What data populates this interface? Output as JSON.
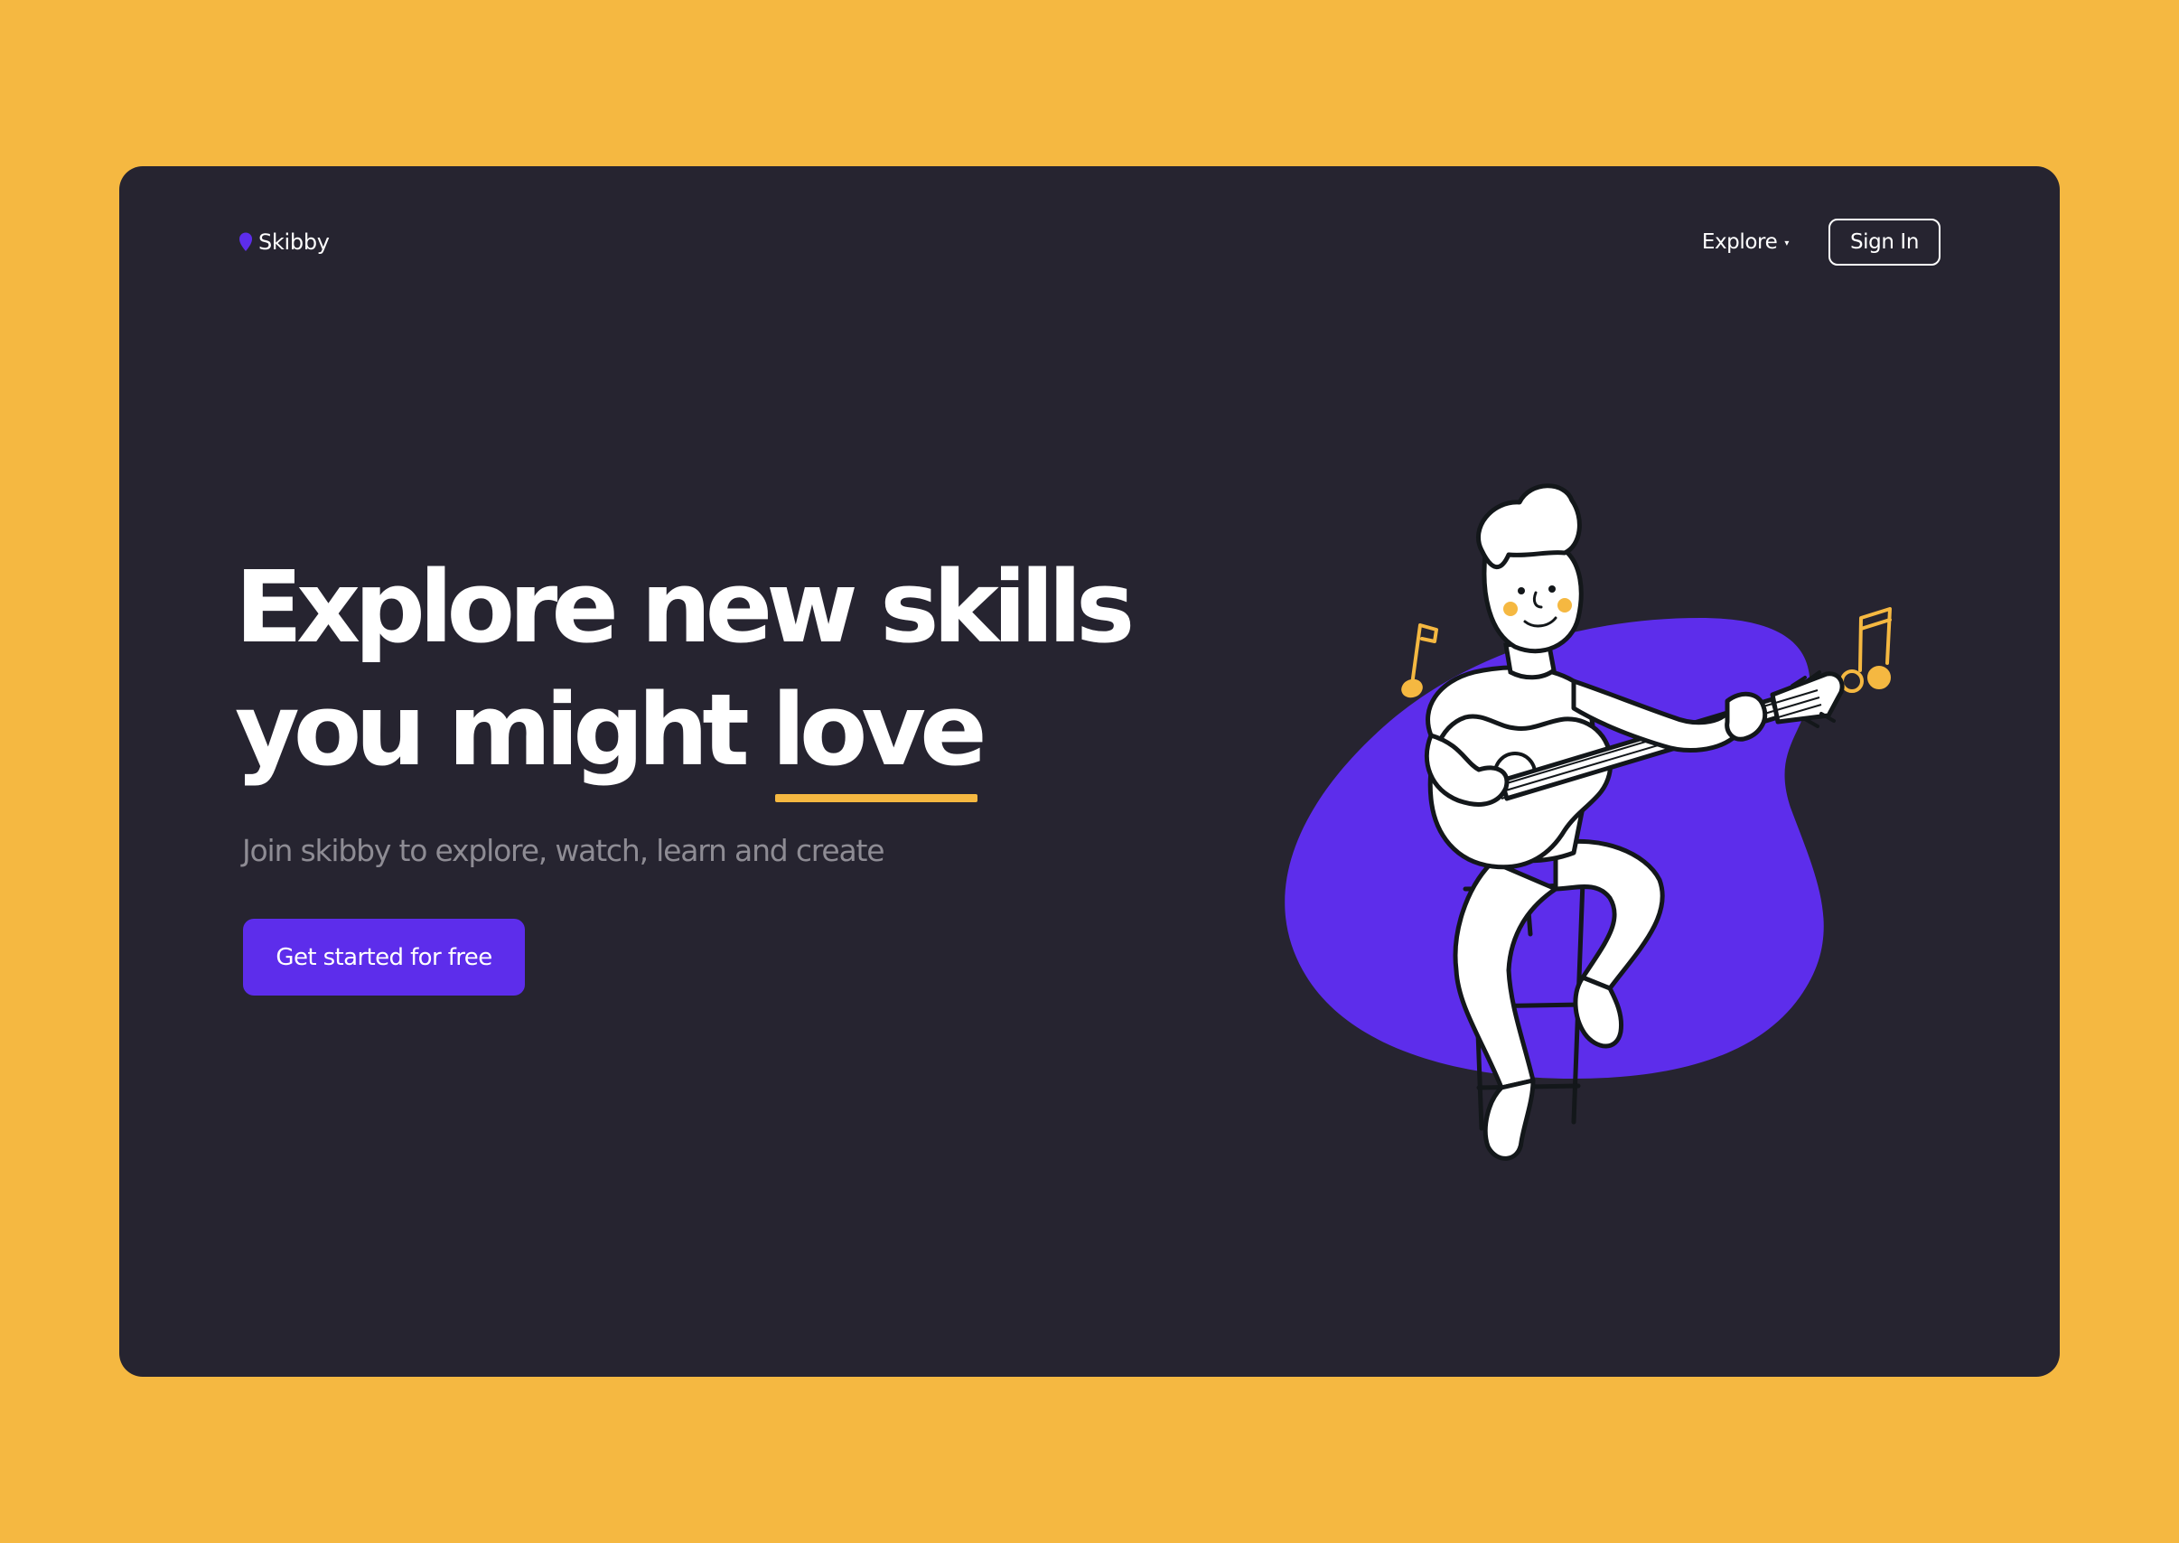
{
  "brand": {
    "name": "Skibby",
    "accent": "#5D2DEB",
    "highlight": "#F5B841",
    "background": "#262430"
  },
  "nav": {
    "explore_label": "Explore",
    "explore_caret": "▾",
    "signin_label": "Sign In"
  },
  "hero": {
    "title_line1": "Explore new skills",
    "title_line2_prefix": "you might ",
    "title_line2_highlight": "love",
    "subtitle": "Join skibby to explore, watch, learn and create",
    "cta_label": "Get started for free"
  },
  "illustration": {
    "subject": "person playing guitar on stool",
    "icons": [
      "music-note-icon",
      "double-music-note-icon"
    ]
  }
}
